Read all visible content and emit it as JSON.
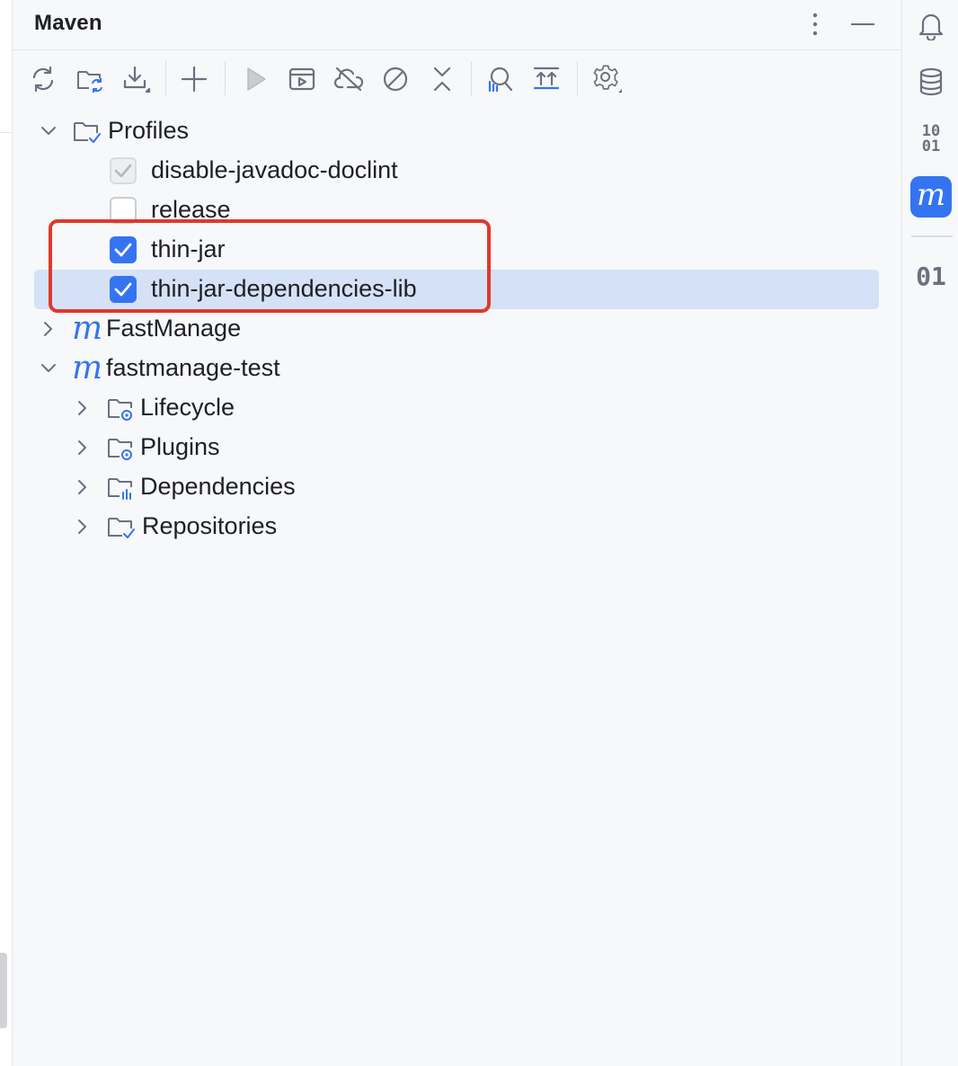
{
  "panel": {
    "title": "Maven"
  },
  "toolbar": {
    "buttons": [
      {
        "name": "reload-all-projects",
        "icon": "refresh-icon"
      },
      {
        "name": "generate-sources",
        "icon": "folder-sync-icon"
      },
      {
        "name": "download-sources",
        "icon": "download-icon"
      },
      {
        "name": "add-maven-project",
        "icon": "plus-icon"
      },
      {
        "name": "run-maven-build",
        "icon": "play-icon"
      },
      {
        "name": "execute-maven-goal",
        "icon": "run-config-icon"
      },
      {
        "name": "toggle-offline-mode",
        "icon": "cloud-off-icon"
      },
      {
        "name": "skip-tests",
        "icon": "prohibited-icon"
      },
      {
        "name": "collapse-all",
        "icon": "collapse-icon"
      },
      {
        "name": "analyze-dependencies",
        "icon": "analyze-icon"
      },
      {
        "name": "show-dependencies",
        "icon": "expand-up-icon"
      },
      {
        "name": "maven-settings",
        "icon": "gear-icon"
      }
    ]
  },
  "tree": {
    "profiles_label": "Profiles",
    "profiles": [
      {
        "label": "disable-javadoc-doclint",
        "state": "disabled-checked"
      },
      {
        "label": "release",
        "state": "unchecked"
      },
      {
        "label": "thin-jar",
        "state": "checked"
      },
      {
        "label": "thin-jar-dependencies-lib",
        "state": "checked"
      }
    ],
    "projects": [
      {
        "label": "FastManage",
        "expanded": false
      },
      {
        "label": "fastmanage-test",
        "expanded": true
      }
    ],
    "children": [
      {
        "label": "Lifecycle",
        "icon": "folder-gear-icon"
      },
      {
        "label": "Plugins",
        "icon": "folder-gear-icon"
      },
      {
        "label": "Dependencies",
        "icon": "folder-chart-icon"
      },
      {
        "label": "Repositories",
        "icon": "folder-check-icon"
      }
    ],
    "maven_letter": "m"
  },
  "rightbar": {
    "items": [
      {
        "name": "notifications",
        "icon": "bell-icon"
      },
      {
        "name": "database",
        "icon": "database-icon"
      },
      {
        "name": "binary-viewer",
        "text_top": "10",
        "text_bottom": "01"
      },
      {
        "name": "maven",
        "icon": "maven-icon",
        "text": "m",
        "active": true
      },
      {
        "name": "bytecode",
        "text": "01"
      }
    ]
  },
  "colors": {
    "accent": "#3574f0",
    "selection": "#d5e1f7",
    "highlight_border": "#e0382b",
    "icon_gray": "#6c707e"
  }
}
